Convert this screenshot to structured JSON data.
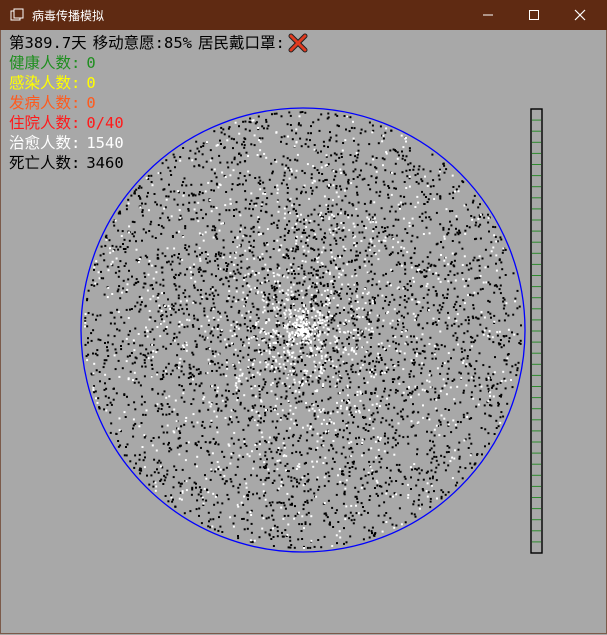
{
  "window": {
    "title": "病毒传播模拟",
    "controls": {
      "minimize": "minimize-icon",
      "maximize": "maximize-icon",
      "close": "close-icon"
    }
  },
  "status": {
    "day": "第389.7天",
    "mobility": "移动意愿:85%",
    "mask_label": "居民戴口罩:",
    "mask_state_icon": "red-x-icon"
  },
  "stats": [
    {
      "label": "健康人数:",
      "value": "0",
      "color": "#1f8f1f"
    },
    {
      "label": "感染人数:",
      "value": "0",
      "color": "#ffff00"
    },
    {
      "label": "发病人数:",
      "value": "0",
      "color": "#ff5a1e"
    },
    {
      "label": "住院人数:",
      "value": "0/40",
      "color": "#ff1a1a"
    },
    {
      "label": "治愈人数:",
      "value": "1540",
      "color": "#ffffff"
    },
    {
      "label": "死亡人数:",
      "value": "3460",
      "color": "#000000"
    }
  ],
  "colors": {
    "background": "#a8a8a8",
    "titlebar": "#5f2a12",
    "city_boundary": "#0000ff",
    "dead_dot": "#000000",
    "cured_dot": "#ffffff",
    "hospital_divider": "#2e8b2e"
  },
  "hospital": {
    "beds": 40,
    "occupied": 0
  }
}
